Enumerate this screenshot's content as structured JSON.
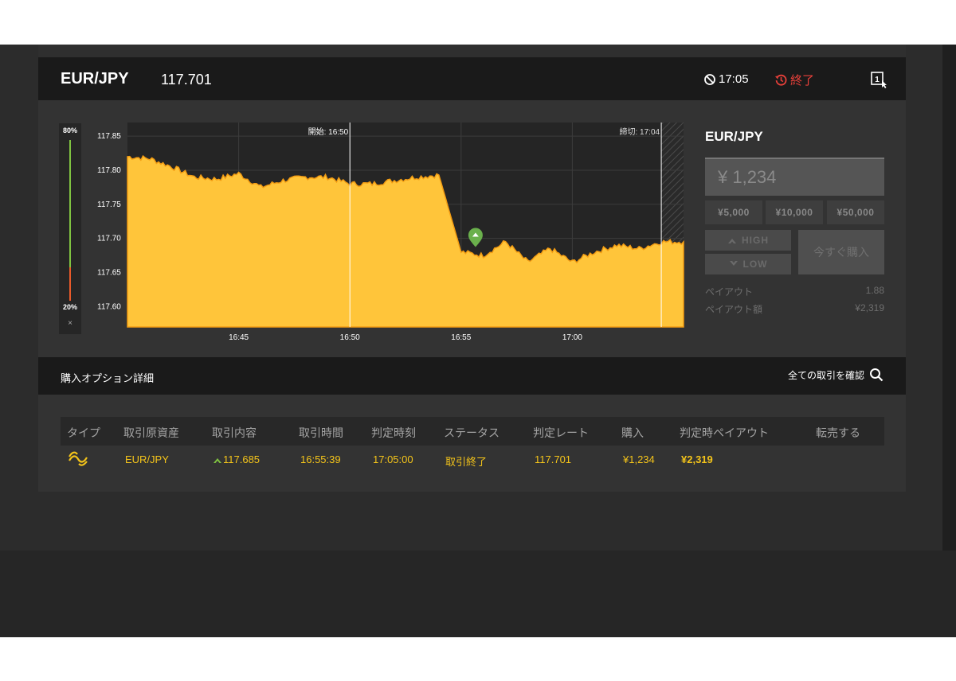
{
  "header": {
    "pair": "EUR/JPY",
    "rate": "117.701",
    "expiry_time": "17:05",
    "status": "終了",
    "colors": {
      "accent": "#f4c41a",
      "closed": "#e8403a",
      "up": "#7fc241"
    }
  },
  "sentiment": {
    "top": "80%",
    "bottom": "20%",
    "close": "×"
  },
  "chart": {
    "y_ticks": [
      "117.85",
      "117.80",
      "117.75",
      "117.70",
      "117.65",
      "117.60"
    ],
    "x_ticks": [
      "16:45",
      "16:50",
      "16:55",
      "17:00"
    ],
    "start_label": "開始: 16:50",
    "deadline_label": "締切: 17:04"
  },
  "chart_data": {
    "type": "area",
    "x": [
      "16:40",
      "16:41",
      "16:42",
      "16:43",
      "16:44",
      "16:45",
      "16:46",
      "16:47",
      "16:48",
      "16:49",
      "16:50",
      "16:51",
      "16:52",
      "16:53",
      "16:54",
      "16:55",
      "16:56",
      "16:57",
      "16:58",
      "16:59",
      "17:00",
      "17:01",
      "17:02",
      "17:03",
      "17:04",
      "17:05"
    ],
    "values": [
      117.82,
      117.817,
      117.805,
      117.79,
      117.787,
      117.795,
      117.775,
      117.785,
      117.79,
      117.79,
      117.78,
      117.78,
      117.785,
      117.79,
      117.793,
      117.68,
      117.675,
      117.695,
      117.665,
      117.685,
      117.665,
      117.68,
      117.69,
      117.685,
      117.695,
      117.695
    ],
    "ylim": [
      117.57,
      117.87
    ],
    "xlim": [
      "16:40",
      "17:05"
    ],
    "markers": {
      "start": "16:50",
      "deadline": "17:04",
      "entry": {
        "x": "16:55:39",
        "y": 117.685
      }
    },
    "color": "#f4c41a",
    "grid": true
  },
  "trade_panel": {
    "title": "EUR/JPY",
    "amount": "¥ 1,234",
    "quick_amounts": [
      "¥5,000",
      "¥10,000",
      "¥50,000"
    ],
    "high_label": "HIGH",
    "low_label": "LOW",
    "buy_now_label": "今すぐ購入",
    "payout_label": "ペイアウト",
    "payout_value": "1.88",
    "payout_amount_label": "ペイアウト額",
    "payout_amount_value": "¥2,319"
  },
  "details": {
    "title": "購入オプション詳細",
    "all_trades_label": "全ての取引を確認"
  },
  "table": {
    "headers": [
      "タイプ",
      "取引原資産",
      "取引内容",
      "取引時間",
      "判定時刻",
      "ステータス",
      "判定レート",
      "購入",
      "判定時ペイアウト",
      "転売する"
    ],
    "rows": [
      {
        "asset": "EUR/JPY",
        "content": "117.685",
        "time": "16:55:39",
        "judge_time": "17:05:00",
        "status": "取引終了",
        "judge_rate": "117.701",
        "purchase": "¥1,234",
        "payout": "¥2,319"
      }
    ]
  }
}
